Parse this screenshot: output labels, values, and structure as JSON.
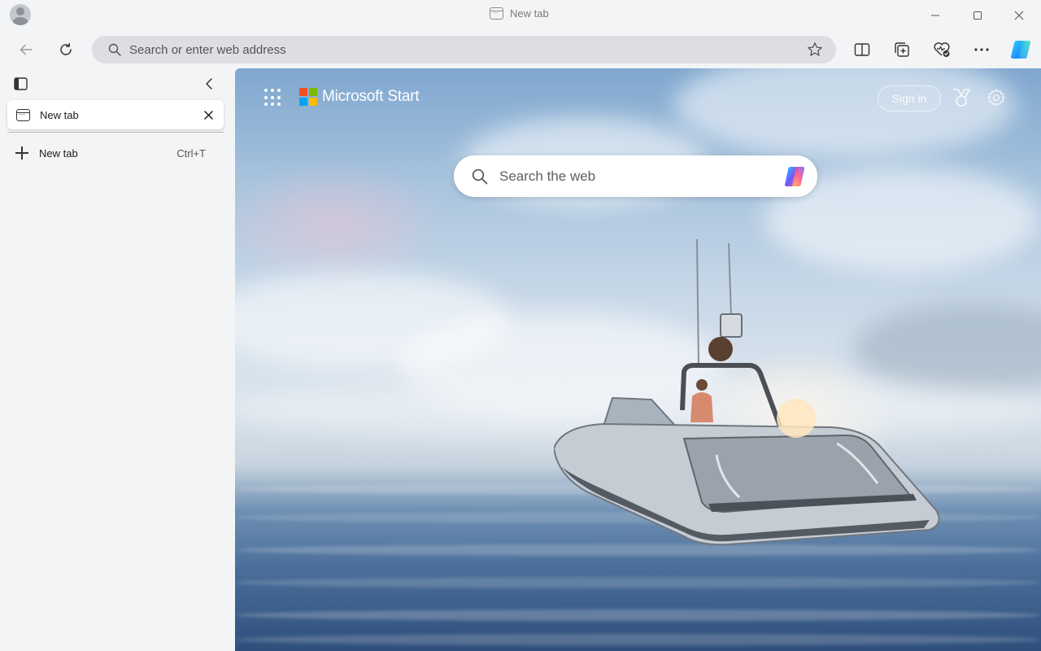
{
  "window": {
    "title": "New tab",
    "icons": [
      "profile-avatar",
      "tab-icon",
      "minimize-icon",
      "maximize-icon",
      "close-icon"
    ]
  },
  "toolbar": {
    "address_placeholder": "Search or enter web address",
    "icons": [
      "back-arrow-icon",
      "refresh-icon",
      "search-icon",
      "favorite-star-icon",
      "split-screen-icon",
      "collections-icon",
      "browser-essentials-icon",
      "more-icon",
      "copilot-icon"
    ]
  },
  "sidebar": {
    "tabs": [
      {
        "label": "New tab"
      }
    ],
    "new_tab": {
      "label": "New tab",
      "shortcut": "Ctrl+T"
    },
    "icons": [
      "vertical-tabs-icon",
      "collapse-chevron-icon",
      "close-tab-icon",
      "plus-icon"
    ]
  },
  "start_page": {
    "brand": "Microsoft Start",
    "sign_in": "Sign in",
    "search_placeholder": "Search the web",
    "icons": [
      "app-launcher-icon",
      "microsoft-logo",
      "rewards-icon",
      "settings-gear-icon",
      "copilot-icon"
    ],
    "background": "speedboat on ocean waves under bright sunlit sky"
  },
  "colors": {
    "chrome_bg": "#f3f4f6",
    "address_bar": "#dcdee2",
    "ms_red": "#f25022",
    "ms_green": "#7fba00",
    "ms_blue": "#00a4ef",
    "ms_yellow": "#ffb900"
  }
}
